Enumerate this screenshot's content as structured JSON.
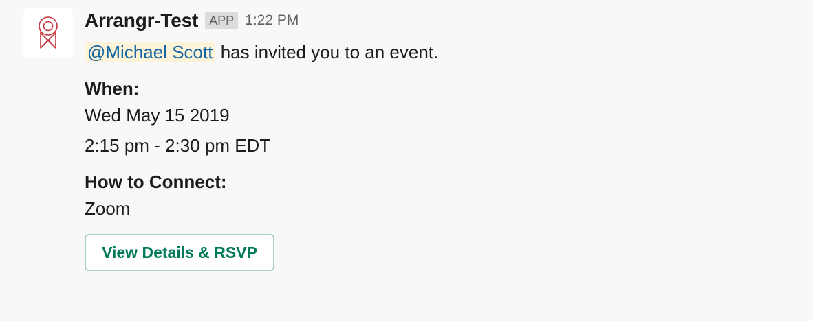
{
  "message": {
    "sender": "Arrangr-Test",
    "badge": "APP",
    "time": "1:22 PM",
    "mention": "@Michael Scott",
    "intro_text": " has invited you to an event."
  },
  "details": {
    "when_label": "When:",
    "date": "Wed May 15 2019",
    "time_range": "2:15 pm - 2:30 pm EDT",
    "connect_label": "How to Connect:",
    "connect_value": "Zoom"
  },
  "actions": {
    "rsvp_label": "View Details & RSVP"
  },
  "colors": {
    "background": "#f8f8f8",
    "mention_bg": "#fdf3d8",
    "mention_text": "#1264a3",
    "button_text": "#007a5a",
    "logo": "#c8323c"
  },
  "icons": {
    "avatar": "arrangr-logo-icon"
  }
}
